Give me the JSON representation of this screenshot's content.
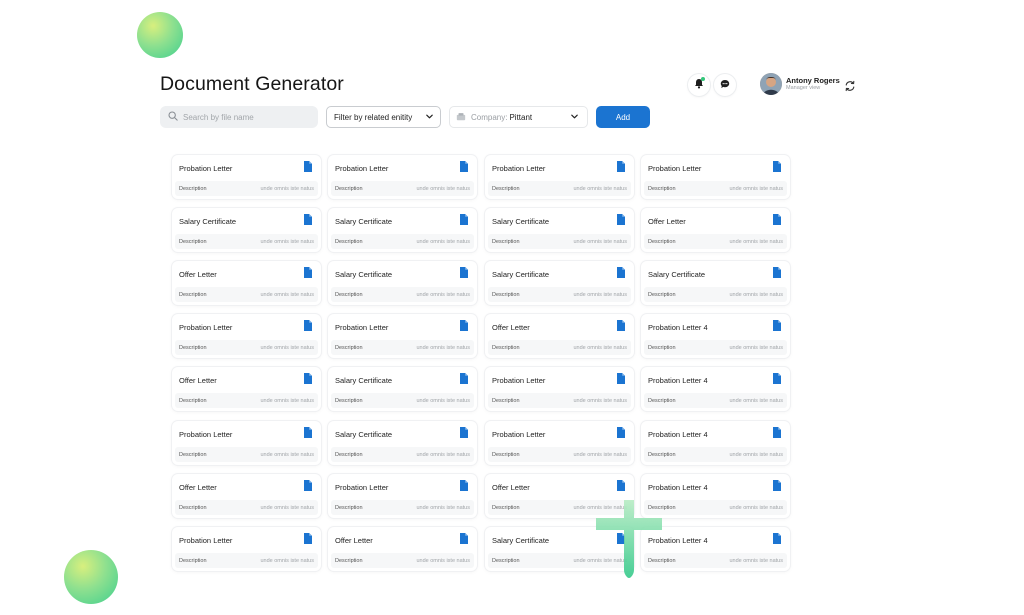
{
  "page": {
    "title": "Document Generator"
  },
  "toolbar": {
    "search_placeholder": "Search by file name",
    "filter_label": "Filter by related enitity",
    "company_prefix": "Company:",
    "company_value": "Pittant",
    "add_label": "Add"
  },
  "user": {
    "name": "Antony Rogers",
    "role": "Manager view"
  },
  "colors": {
    "accent": "#1b74d1",
    "blob_green": "#3fcf8f",
    "notification_dot": "#34c77b"
  },
  "icons": {
    "search": "search-icon",
    "chevron": "chevron-down-icon",
    "company": "building-icon",
    "bell": "bell-icon",
    "chat": "chat-icon",
    "refresh": "refresh-icon",
    "document": "document-icon"
  },
  "documents": [
    [
      {
        "title": "Probation Letter",
        "desc_label": "Description",
        "desc_value": "unde omnis iste natus"
      },
      {
        "title": "Probation Letter",
        "desc_label": "Description",
        "desc_value": "unde omnis iste natus"
      },
      {
        "title": "Probation Letter",
        "desc_label": "Description",
        "desc_value": "unde omnis iste natus"
      },
      {
        "title": "Probation Letter",
        "desc_label": "Description",
        "desc_value": "unde omnis iste natus"
      }
    ],
    [
      {
        "title": "Salary Certificate",
        "desc_label": "Description",
        "desc_value": "unde omnis iste natus"
      },
      {
        "title": "Salary Certificate",
        "desc_label": "Description",
        "desc_value": "unde omnis iste natus"
      },
      {
        "title": "Salary Certificate",
        "desc_label": "Description",
        "desc_value": "unde omnis iste natus"
      },
      {
        "title": "Offer Letter",
        "desc_label": "Description",
        "desc_value": "unde omnis iste natus"
      }
    ],
    [
      {
        "title": "Offer Letter",
        "desc_label": "Description",
        "desc_value": "unde omnis iste natus"
      },
      {
        "title": "Salary Certificate",
        "desc_label": "Description",
        "desc_value": "unde omnis iste natus"
      },
      {
        "title": "Salary Certificate",
        "desc_label": "Description",
        "desc_value": "unde omnis iste natus"
      },
      {
        "title": "Salary Certificate",
        "desc_label": "Description",
        "desc_value": "unde omnis iste natus"
      }
    ],
    [
      {
        "title": "Probation Letter",
        "desc_label": "Description",
        "desc_value": "unde omnis iste natus"
      },
      {
        "title": "Probation Letter",
        "desc_label": "Description",
        "desc_value": "unde omnis iste natus"
      },
      {
        "title": "Offer Letter",
        "desc_label": "Description",
        "desc_value": "unde omnis iste natus"
      },
      {
        "title": "Probation Letter 4",
        "desc_label": "Description",
        "desc_value": "unde omnis iste natus"
      }
    ],
    [
      {
        "title": "Offer Letter",
        "desc_label": "Description",
        "desc_value": "unde omnis iste natus"
      },
      {
        "title": "Salary Certificate",
        "desc_label": "Description",
        "desc_value": "unde omnis iste natus"
      },
      {
        "title": "Probation Letter",
        "desc_label": "Description",
        "desc_value": "unde omnis iste natus"
      },
      {
        "title": "Probation Letter 4",
        "desc_label": "Description",
        "desc_value": "unde omnis iste natus"
      }
    ],
    [
      {
        "title": "Probation Letter",
        "desc_label": "Description",
        "desc_value": "unde omnis iste natus"
      },
      {
        "title": "Salary Certificate",
        "desc_label": "Description",
        "desc_value": "unde omnis iste natus"
      },
      {
        "title": "Probation Letter",
        "desc_label": "Description",
        "desc_value": "unde omnis iste natus"
      },
      {
        "title": "Probation Letter 4",
        "desc_label": "Description",
        "desc_value": "unde omnis iste natus"
      }
    ],
    [
      {
        "title": "Offer Letter",
        "desc_label": "Description",
        "desc_value": "unde omnis iste natus"
      },
      {
        "title": "Probation Letter",
        "desc_label": "Description",
        "desc_value": "unde omnis iste natus"
      },
      {
        "title": "Offer Letter",
        "desc_label": "Description",
        "desc_value": "unde omnis iste natus"
      },
      {
        "title": "Probation Letter 4",
        "desc_label": "Description",
        "desc_value": "unde omnis iste natus"
      }
    ],
    [
      {
        "title": "Probation Letter",
        "desc_label": "Description",
        "desc_value": "unde omnis iste natus"
      },
      {
        "title": "Offer Letter",
        "desc_label": "Description",
        "desc_value": "unde omnis iste natus"
      },
      {
        "title": "Salary Certificate",
        "desc_label": "Description",
        "desc_value": "unde omnis iste natus"
      },
      {
        "title": "Probation Letter 4",
        "desc_label": "Description",
        "desc_value": "unde omnis iste natus"
      }
    ]
  ]
}
